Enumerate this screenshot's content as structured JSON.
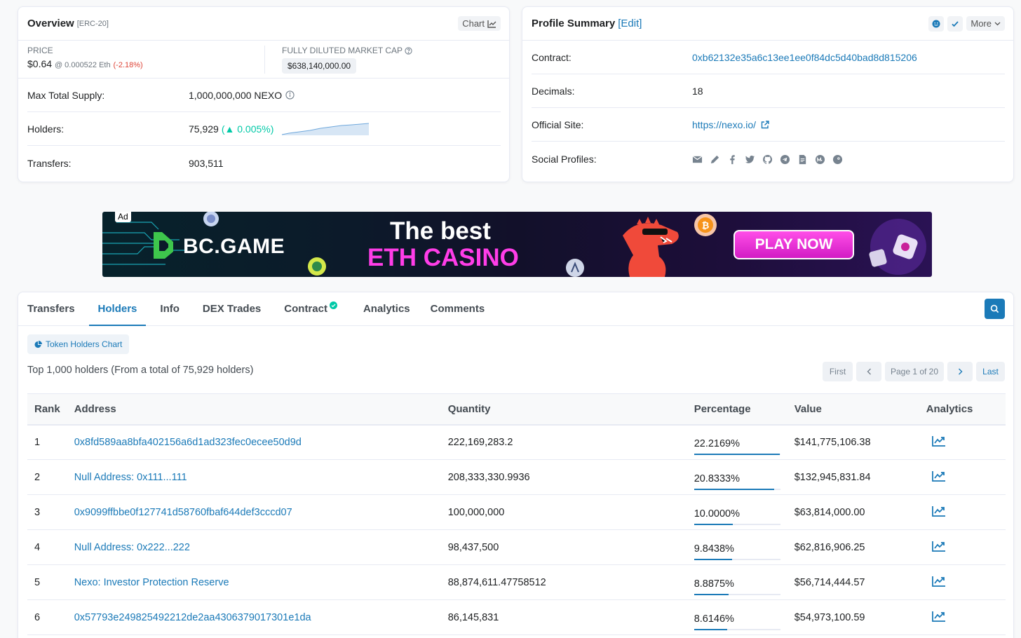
{
  "overview": {
    "title": "Overview",
    "token_type": "[ERC-20]",
    "chart_label": "Chart",
    "price_label": "PRICE",
    "price": "$0.64",
    "price_eth": "@ 0.000522 Eth",
    "price_change": "(-2.18%)",
    "mcap_label": "FULLY DILUTED MARKET CAP",
    "mcap_value": "$638,140,000.00",
    "max_supply_label": "Max Total Supply:",
    "max_supply_value": "1,000,000,000 NEXO",
    "holders_label": "Holders:",
    "holders_value": "75,929",
    "holders_change": "(▲ 0.005%)",
    "transfers_label": "Transfers:",
    "transfers_value": "903,511"
  },
  "profile": {
    "title": "Profile Summary",
    "edit_label": "[Edit]",
    "more_label": "More",
    "contract_label": "Contract:",
    "contract_value": "0xb62132e35a6c13ee1ee0f84dc5d40bad8d815206",
    "decimals_label": "Decimals:",
    "decimals_value": "18",
    "site_label": "Official Site:",
    "site_value": "https://nexo.io/",
    "social_label": "Social Profiles:",
    "social_icons": [
      "email-icon",
      "pencil-icon",
      "facebook-icon",
      "twitter-icon",
      "github-icon",
      "telegram-icon",
      "whitepaper-icon",
      "coinmarketcap-icon",
      "coingecko-icon"
    ]
  },
  "ad": {
    "badge": "Ad",
    "brand": "BC.GAME",
    "headline_1": "The best",
    "headline_2": "ETH CASINO",
    "cta": "PLAY NOW"
  },
  "tabs": [
    {
      "label": "Transfers"
    },
    {
      "label": "Holders"
    },
    {
      "label": "Info"
    },
    {
      "label": "DEX Trades"
    },
    {
      "label": "Contract"
    },
    {
      "label": "Analytics"
    },
    {
      "label": "Comments"
    }
  ],
  "holders": {
    "chart_button": "Token Holders Chart",
    "summary": "Top 1,000 holders (From a total of 75,929 holders)",
    "pagination": {
      "first": "First",
      "page": "Page 1 of 20",
      "last": "Last"
    },
    "columns": [
      "Rank",
      "Address",
      "Quantity",
      "Percentage",
      "Value",
      "Analytics"
    ],
    "rows": [
      {
        "rank": "1",
        "address": "0x8fd589aa8bfa402156a6d1ad323fec0ecee50d9d",
        "quantity": "222,169,283.2",
        "percentage": "22.2169%",
        "pct": 22.2169,
        "value": "$141,775,106.38"
      },
      {
        "rank": "2",
        "address": "Null Address: 0x111...111",
        "quantity": "208,333,330.9936",
        "percentage": "20.8333%",
        "pct": 20.8333,
        "value": "$132,945,831.84"
      },
      {
        "rank": "3",
        "address": "0x9099ffbbe0f127741d58760fbaf644def3cccd07",
        "quantity": "100,000,000",
        "percentage": "10.0000%",
        "pct": 10.0,
        "value": "$63,814,000.00"
      },
      {
        "rank": "4",
        "address": "Null Address: 0x222...222",
        "quantity": "98,437,500",
        "percentage": "9.8438%",
        "pct": 9.8438,
        "value": "$62,816,906.25"
      },
      {
        "rank": "5",
        "address": "Nexo: Investor Protection Reserve",
        "quantity": "88,874,611.47758512",
        "percentage": "8.8875%",
        "pct": 8.8875,
        "value": "$56,714,444.57"
      },
      {
        "rank": "6",
        "address": "0x57793e249825492212de2aa4306379017301e1da",
        "quantity": "86,145,831",
        "percentage": "8.6146%",
        "pct": 8.6146,
        "value": "$54,973,100.59"
      }
    ]
  },
  "colors": {
    "link": "#1b7ab8",
    "negative": "#de4437",
    "positive": "#00c9a7"
  }
}
